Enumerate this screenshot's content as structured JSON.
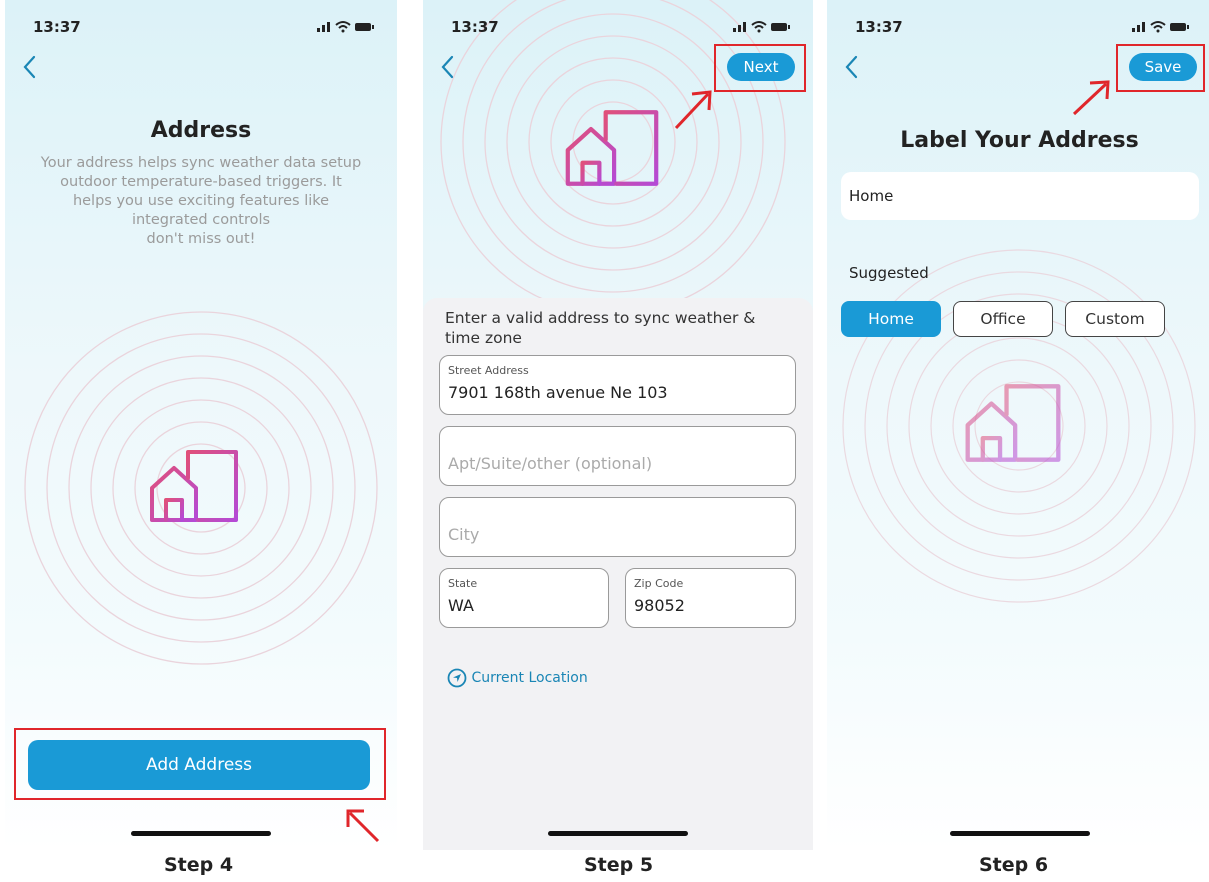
{
  "colors": {
    "accent": "#1a9ad6",
    "highlight": "#e0262b",
    "icon_gradient_start": "#e0507a",
    "icon_gradient_end": "#b44ad6"
  },
  "step4": {
    "status": {
      "time": "13:37"
    },
    "title": "Address",
    "description_lines": [
      "Your address helps sync weather data setup",
      "outdoor temperature-based triggers. It",
      "helps you use exciting features like",
      "integrated controls",
      "don't miss out!"
    ],
    "add_address_label": "Add Address",
    "step_label": "Step 4"
  },
  "step5": {
    "status": {
      "time": "13:37"
    },
    "next_label": "Next",
    "sheet_title": "Enter a valid address to sync weather & time zone",
    "street": {
      "label": "Street Address",
      "value": "7901 168th avenue Ne 103"
    },
    "apt": {
      "placeholder": "Apt/Suite/other (optional)"
    },
    "city": {
      "placeholder": "City"
    },
    "state": {
      "label": "State",
      "value": "WA"
    },
    "zip": {
      "label": "Zip Code",
      "value": "98052"
    },
    "current_location_label": "Current Location",
    "step_label": "Step 5"
  },
  "step6": {
    "status": {
      "time": "13:37"
    },
    "save_label": "Save",
    "title": "Label Your Address",
    "label_value": "Home",
    "suggested_label": "Suggested",
    "chips": [
      "Home",
      "Office",
      "Custom"
    ],
    "selected_chip": "Home",
    "step_label": "Step 6"
  }
}
